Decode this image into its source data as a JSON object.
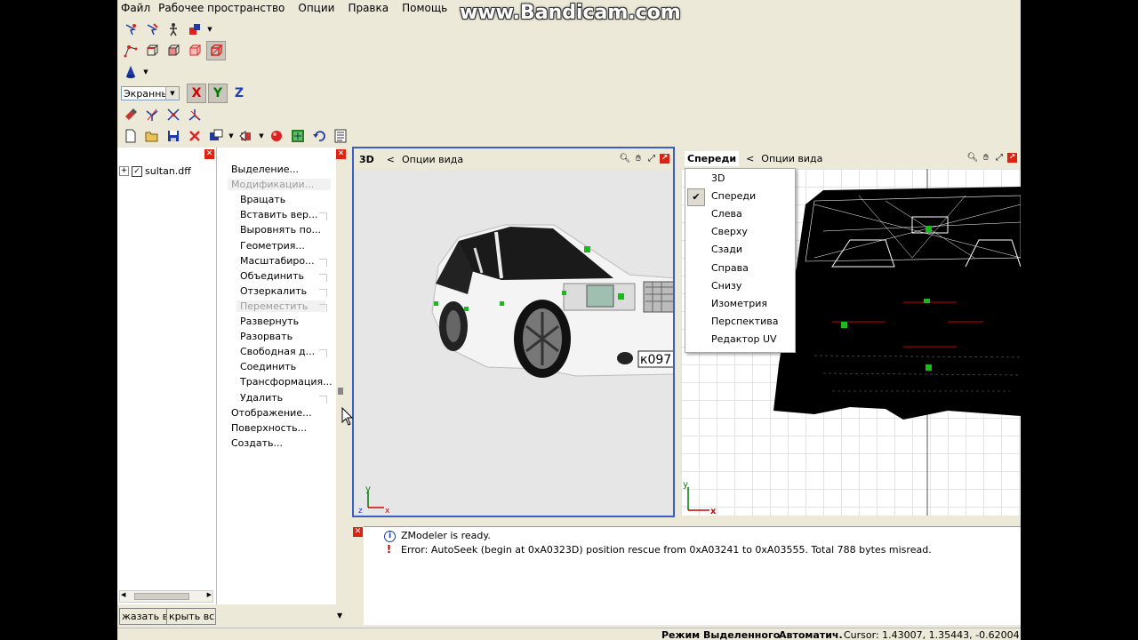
{
  "watermark": "www.Bandicam.com",
  "menu": [
    "Файл",
    "Рабочее пространство",
    "Опции",
    "Правка",
    "Помощь"
  ],
  "toolbar": {
    "combo_value": "Экранны",
    "axes": [
      "X",
      "Y",
      "Z"
    ],
    "axis_colors": {
      "x": "#d00000",
      "y": "#007a00",
      "z": "#1d3fbf"
    }
  },
  "tree": {
    "items": [
      {
        "label": "sultan.dff",
        "checked": true
      }
    ],
    "buttons": [
      "жазать в",
      "крыть вс"
    ]
  },
  "commands": {
    "items": [
      {
        "label": "Выделение...",
        "level": 0,
        "disabled": false
      },
      {
        "label": "Модификации...",
        "level": 0,
        "disabled": true
      },
      {
        "label": "Вращать",
        "level": 1,
        "disabled": false
      },
      {
        "label": "Вставить вер...",
        "level": 1,
        "disabled": false
      },
      {
        "label": "Выровнять по...",
        "level": 1,
        "disabled": false
      },
      {
        "label": "Геометрия...",
        "level": 1,
        "disabled": false
      },
      {
        "label": "Масштабиро...",
        "level": 1,
        "disabled": false
      },
      {
        "label": "Объединить",
        "level": 1,
        "disabled": false
      },
      {
        "label": "Отзеркалить",
        "level": 1,
        "disabled": false
      },
      {
        "label": "Переместить",
        "level": 1,
        "disabled": true
      },
      {
        "label": "Развернуть",
        "level": 1,
        "disabled": false
      },
      {
        "label": "Разорвать",
        "level": 1,
        "disabled": false
      },
      {
        "label": "Свободная д...",
        "level": 1,
        "disabled": false
      },
      {
        "label": "Соединить",
        "level": 1,
        "disabled": false
      },
      {
        "label": "Трансформация...",
        "level": 1,
        "disabled": false
      },
      {
        "label": "Удалить",
        "level": 1,
        "disabled": false
      },
      {
        "label": "Отображение...",
        "level": 0,
        "disabled": false
      },
      {
        "label": "Поверхность...",
        "level": 0,
        "disabled": false
      },
      {
        "label": "Создать...",
        "level": 0,
        "disabled": false
      }
    ]
  },
  "viewport_left": {
    "tab": "3D",
    "options_label": "Опции вида",
    "plate": "к097"
  },
  "viewport_right": {
    "tab": "Спереди",
    "options_label": "Опции вида"
  },
  "view_menu": {
    "items": [
      "3D",
      "Спереди",
      "Слева",
      "Сверху",
      "Сзади",
      "Справа",
      "Снизу",
      "Изометрия",
      "Перспектива",
      "Редактор UV"
    ],
    "checked_index": 1
  },
  "log": {
    "lines": [
      {
        "type": "info",
        "text": "ZModeler is ready."
      },
      {
        "type": "error",
        "text": "Error: AutoSeek (begin at 0xA0323D) position rescue  from 0xA03241 to 0xA03555. Total 788 bytes misread."
      }
    ]
  },
  "status": {
    "mode": "Режим Выделенного",
    "auto": "Автоматич.",
    "cursor": "Cursor: 1.43007, 1.35443, -0.62004"
  },
  "axis_labels": {
    "x": "x",
    "y": "y",
    "z": "z"
  }
}
